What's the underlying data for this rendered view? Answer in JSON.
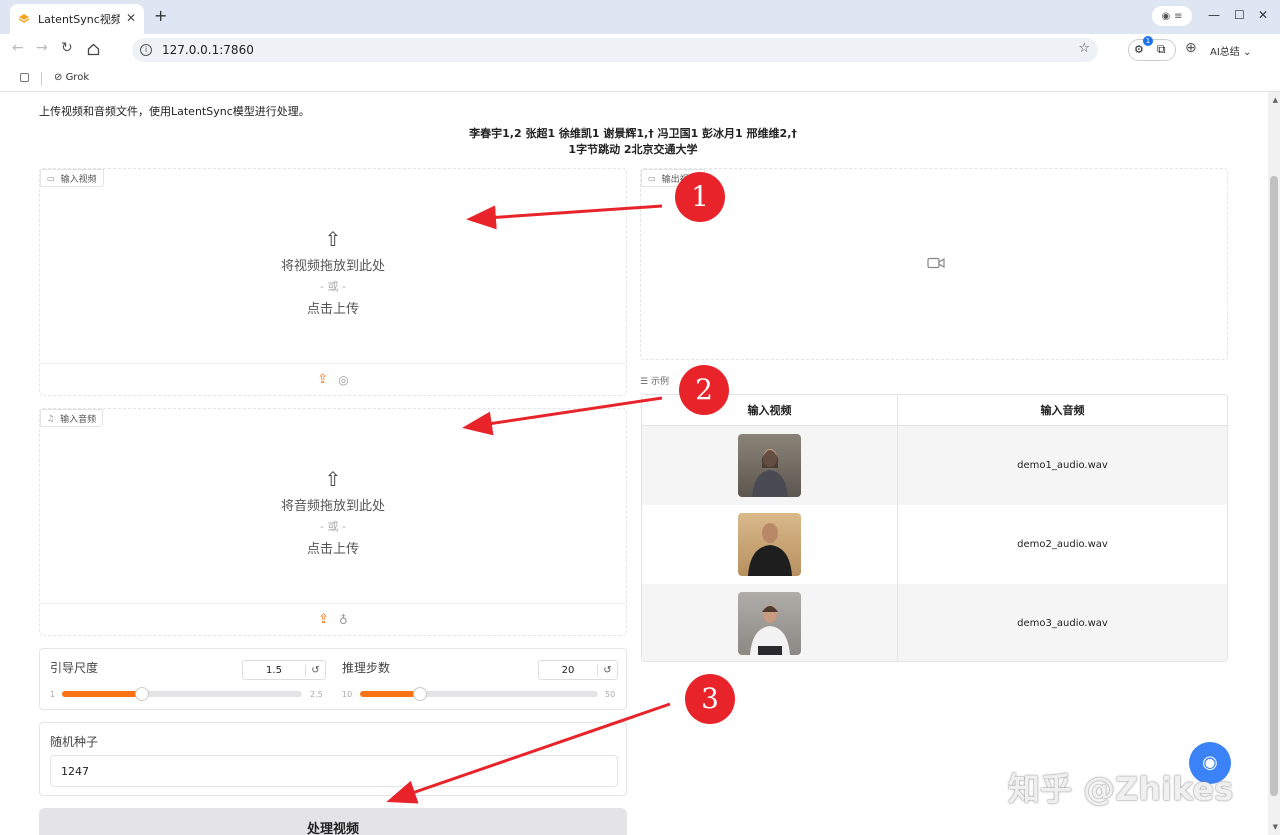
{
  "browser": {
    "tab_title": "LatentSync视频处",
    "tab_close": "✕",
    "new_tab": "+",
    "url": "127.0.0.1:7860",
    "ai_label": "AI总结",
    "ext_badge": "1",
    "bookmark_grok": "Grok",
    "window_controls": {
      "minimize": "—",
      "maximize": "☐",
      "close": "✕"
    }
  },
  "page": {
    "description": "上传视频和音频文件，使用LatentSync模型进行处理。",
    "authors_line1": "李春宇1,2 张超1 徐维凯1 谢景辉1,† 冯卫国1 彭冰月1 邢维维2,†",
    "authors_line2": "1字节跳动 2北京交通大学"
  },
  "video_input": {
    "label": "输入视频",
    "drop_text": "将视频拖放到此处",
    "or_text": "- 或 -",
    "click_text": "点击上传"
  },
  "audio_input": {
    "label": "输入音频",
    "drop_text": "将音频拖放到此处",
    "or_text": "- 或 -",
    "click_text": "点击上传"
  },
  "video_output": {
    "label": "输出视频"
  },
  "examples": {
    "label": "示例",
    "headers": [
      "输入视频",
      "输入音频"
    ],
    "rows": [
      {
        "audio": "demo1_audio.wav"
      },
      {
        "audio": "demo2_audio.wav"
      },
      {
        "audio": "demo3_audio.wav"
      }
    ]
  },
  "guidance": {
    "label": "引导尺度",
    "value": "1.5",
    "min": "1",
    "max": "2.5",
    "fraction": 0.333
  },
  "steps": {
    "label": "推理步数",
    "value": "20",
    "min": "10",
    "max": "50",
    "fraction": 0.25
  },
  "seed": {
    "label": "随机种子",
    "value": "1247"
  },
  "process_button": "处理视频",
  "reset_glyph": "↺",
  "annotations": [
    "1",
    "2",
    "3"
  ],
  "watermark": "知乎 @Zhikes",
  "colors": {
    "accent": "#f97316",
    "annotation": "#e8232a",
    "fab": "#3b82f6"
  },
  "icons": [
    "upload-icon",
    "webcam-icon",
    "microphone-icon",
    "video-camera-icon",
    "music-note-icon",
    "list-icon",
    "reset-icon",
    "star-icon",
    "refresh-icon",
    "home-icon",
    "back-icon",
    "forward-icon",
    "download-icon",
    "extension-icon",
    "podcast-icon"
  ]
}
